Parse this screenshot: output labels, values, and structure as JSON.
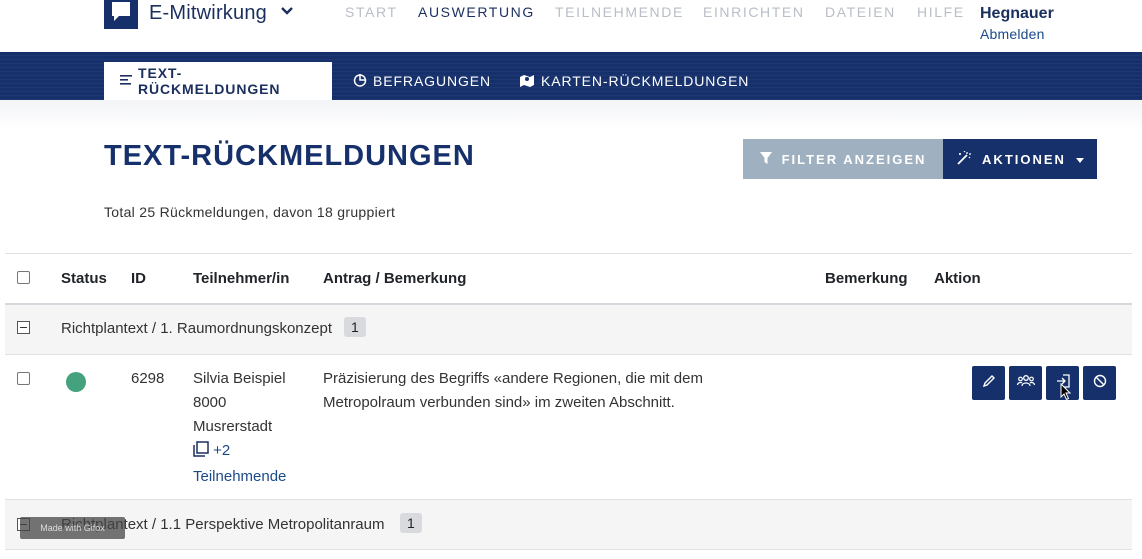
{
  "app": {
    "name": "E-Mitwirkung"
  },
  "nav": {
    "items": [
      {
        "label": "START",
        "active": false
      },
      {
        "label": "AUSWERTUNG",
        "active": true
      },
      {
        "label": "TEILNEHMENDE",
        "active": false
      },
      {
        "label": "EINRICHTEN",
        "active": false
      },
      {
        "label": "DATEIEN",
        "active": false
      },
      {
        "label": "HILFE",
        "active": false
      }
    ]
  },
  "user": {
    "name": "Hegnauer",
    "logout": "Abmelden"
  },
  "subnav": {
    "tabs": [
      {
        "label": "TEXT-RÜCKMELDUNGEN",
        "icon": "align-left-icon",
        "active": true
      },
      {
        "label": "BEFRAGUNGEN",
        "icon": "pie-chart-icon",
        "active": false
      },
      {
        "label": "KARTEN-RÜCKMELDUNGEN",
        "icon": "map-icon",
        "active": false
      }
    ]
  },
  "page": {
    "title": "TEXT-RÜCKMELDUNGEN",
    "filter_button": "FILTER ANZEIGEN",
    "actions_button": "AKTIONEN",
    "summary": "Total 25 Rückmeldungen, davon 18 gruppiert"
  },
  "table": {
    "headers": {
      "status": "Status",
      "id": "ID",
      "participant": "Teilnehmer/in",
      "request": "Antrag / Bemerkung",
      "remark": "Bemerkung",
      "action": "Aktion"
    },
    "groups": [
      {
        "label": "Richtplantext / 1. Raumordnungskonzept",
        "count": "1",
        "rows": [
          {
            "status_color": "#45a27e",
            "id": "6298",
            "participant_name": "Silvia Beispiel",
            "participant_zip": "8000",
            "participant_city": "Musrerstadt",
            "more_count": "+2",
            "more_label": "Teilnehmende",
            "text_line1": "Präzisierung des Begriffs «andere Regionen, die mit dem",
            "text_line2": "Metropolraum verbunden sind» im zweiten Abschnitt.",
            "actions": [
              "pencil-icon",
              "users-icon",
              "sign-in-icon",
              "ban-icon"
            ]
          }
        ]
      },
      {
        "label": "Richtplantext / 1.1 Perspektive Metropolitanraum",
        "count": "1"
      }
    ]
  },
  "watermark": "Made with Gifox",
  "colors": {
    "primary": "#16306b",
    "filter_button": "#9fb0c1",
    "status_green": "#45a27e"
  }
}
